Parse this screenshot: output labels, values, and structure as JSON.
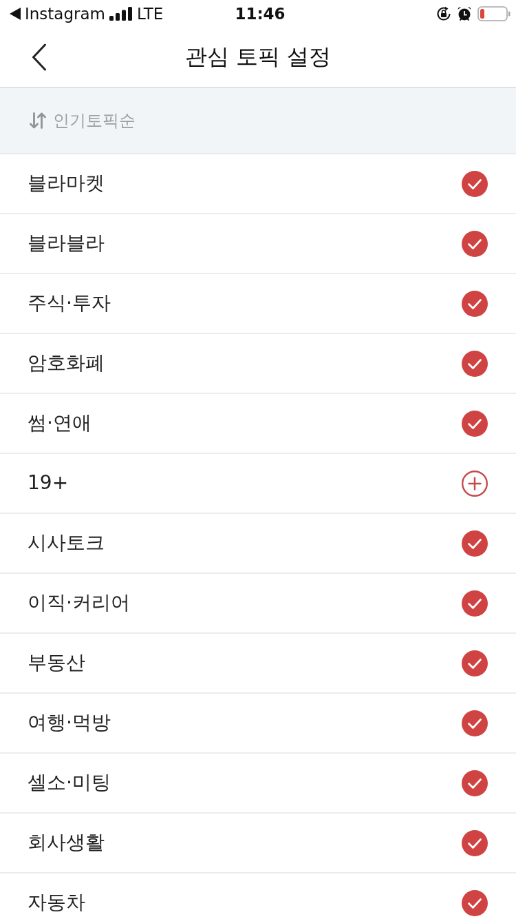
{
  "status_bar": {
    "back_app": "Instagram",
    "carrier": "LTE",
    "time": "11:46"
  },
  "nav": {
    "title": "관심 토픽 설정"
  },
  "sort": {
    "label": "인기토픽순"
  },
  "topics": [
    {
      "name": "블라마켓",
      "selected": true
    },
    {
      "name": "블라블라",
      "selected": true
    },
    {
      "name": "주식·투자",
      "selected": true
    },
    {
      "name": "암호화폐",
      "selected": true
    },
    {
      "name": "썸·연애",
      "selected": true
    },
    {
      "name": "19+",
      "selected": false
    },
    {
      "name": "시사토크",
      "selected": true
    },
    {
      "name": "이직·커리어",
      "selected": true
    },
    {
      "name": "부동산",
      "selected": true
    },
    {
      "name": "여행·먹방",
      "selected": true
    },
    {
      "name": "셀소·미팅",
      "selected": true
    },
    {
      "name": "회사생활",
      "selected": true
    },
    {
      "name": "자동차",
      "selected": true
    }
  ]
}
